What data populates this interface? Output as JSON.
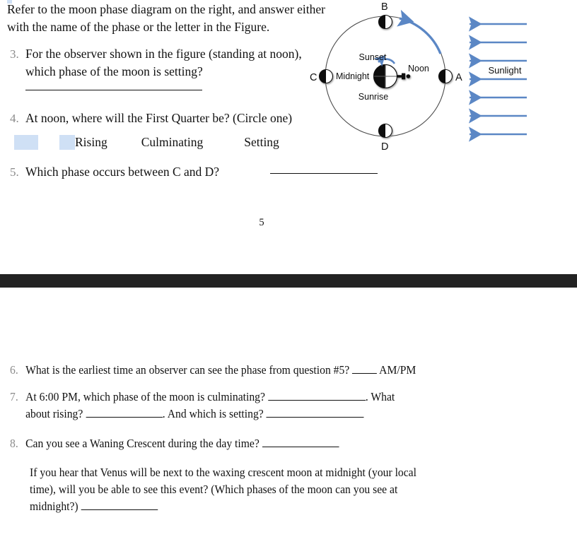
{
  "document": {
    "page_number": "5",
    "intro_text": "Refer to the moon phase diagram on the right, and answer either with the name of the phase or the letter in the Figure.",
    "separator_color": "#232323",
    "highlight_color": "#cfe0f5",
    "arrow_color": "#5b87c5"
  },
  "questions_top": [
    {
      "number": "3.",
      "text": "For the observer shown in the figure (standing at noon), which phase of the moon is setting?",
      "answer_blank": ""
    },
    {
      "number": "4.",
      "text": "At noon, where will the First Quarter be? (Circle one)",
      "options": [
        "Rising",
        "Culminating",
        "Setting"
      ]
    },
    {
      "number": "5.",
      "text": "Which phase occurs between C and D?",
      "answer_blank": ""
    }
  ],
  "questions_bottom": [
    {
      "number": "6.",
      "text_before": "What is the earliest time an observer can see the phase from question #5?",
      "text_after": "AM/PM"
    },
    {
      "number": "7.",
      "line1_before": "At 6:00 PM, which phase of the moon is culminating?",
      "line1_after": ".  What",
      "line2_a": "about rising?",
      "line2_b": ".  And which is setting?"
    },
    {
      "number": "8.",
      "text": "Can you see a Waning Crescent during the day time?"
    },
    {
      "number": "",
      "paragraph_line1": "If you hear that Venus will be next to the waxing crescent moon at midnight (your local",
      "paragraph_line2": "time), will you be able to see this event?  (Which phases of the moon can you see at",
      "paragraph_line3": "midnight?)"
    }
  ],
  "diagram": {
    "title": "moon-phase-orbit-diagram",
    "moon_labels": {
      "top": "B",
      "right": "A",
      "left": "C",
      "bottom": "D"
    },
    "earth_labels": {
      "noon": "Noon",
      "sunset": "Sunset",
      "sunrise": "Sunrise",
      "midnight": "Midnight"
    },
    "sunlight_label": "Sunlight",
    "sunlight_arrow_count": 7,
    "sunlight_direction": "left",
    "orbit_direction": "counter-clockwise"
  }
}
